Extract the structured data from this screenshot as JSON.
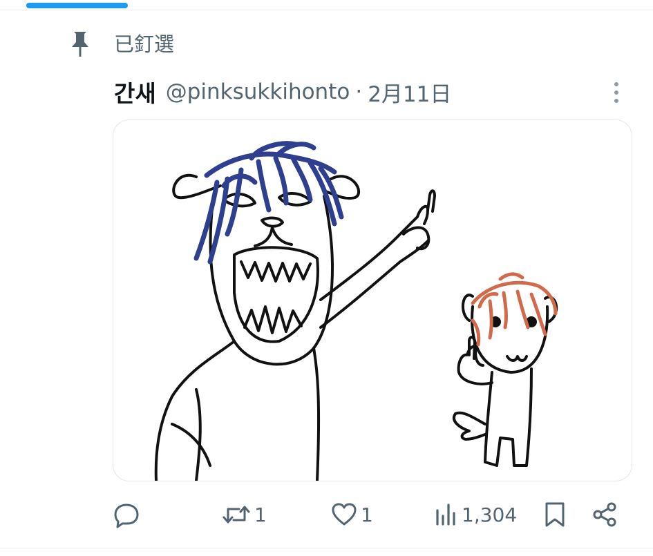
{
  "pinned": {
    "label": "已釘選",
    "icon": "pin-icon"
  },
  "tweet": {
    "display_name": "간새",
    "handle": "@pinksukkihonto",
    "separator": "·",
    "date": "2月11日",
    "more_icon": "more-vertical-icon",
    "media": {
      "subject_icon": "drawing-image",
      "hair_color_left": "#2e3f8f",
      "hair_color_right": "#d06a4a"
    }
  },
  "actions": {
    "reply": {
      "icon": "reply-icon",
      "count": ""
    },
    "retweet": {
      "icon": "retweet-icon",
      "count": "1"
    },
    "like": {
      "icon": "heart-icon",
      "count": "1"
    },
    "views": {
      "icon": "views-icon",
      "count": "1,304"
    },
    "bookmark": {
      "icon": "bookmark-icon"
    },
    "share": {
      "icon": "share-icon"
    }
  },
  "colors": {
    "accent": "#1d9bf0",
    "secondary_text": "#536471",
    "primary_text": "#0f1419"
  }
}
